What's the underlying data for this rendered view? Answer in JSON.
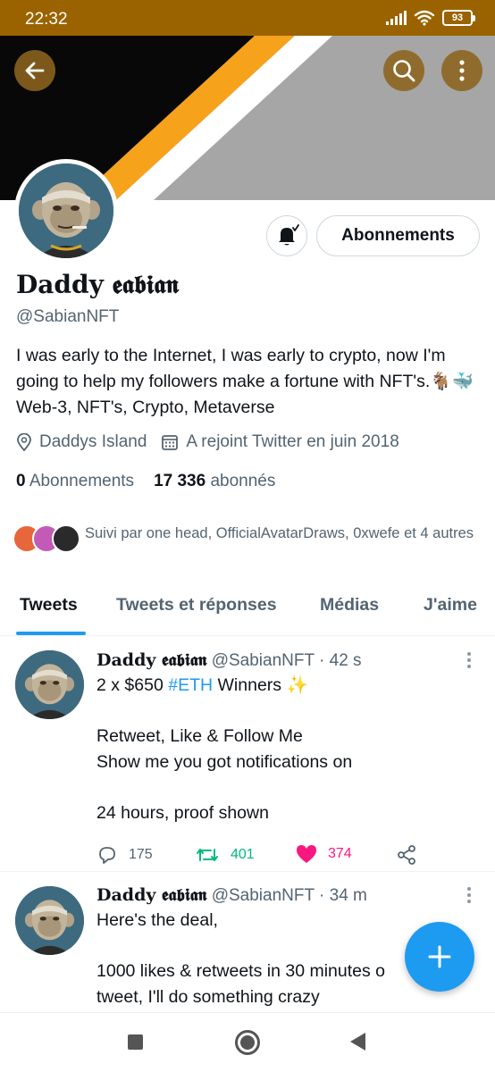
{
  "status_bar": {
    "time": "22:32",
    "battery": "93"
  },
  "banner": {
    "back_icon": "arrow-left-icon",
    "search_icon": "search-icon",
    "more_icon": "more-vertical-icon"
  },
  "profile": {
    "display_name": "Daddy 𝖊𝖆𝖇𝖎𝖆𝖓",
    "handle": "@SabianNFT",
    "bio": "I was early to the Internet, I was early to crypto, now I'm going to help my followers make a fortune with NFT's.🐐🐳 Web-3, NFT's, Crypto, Metaverse",
    "location": "Daddys Island",
    "joined": "A rejoint Twitter en juin 2018",
    "following_count": "0",
    "following_label": "Abonnements",
    "followers_count": "17 336",
    "followers_label": "abonnés",
    "follow_button": "Abonnements",
    "followed_by": "Suivi par one head, OfficialAvatarDraws, 0xwefe et 4 autres"
  },
  "tabs": [
    "Tweets",
    "Tweets et réponses",
    "Médias",
    "J'aime"
  ],
  "tweets": [
    {
      "name": "Daddy 𝖊𝖆𝖇𝖎𝖆𝖓",
      "handle": "@SabianNFT",
      "time": "· 42 s",
      "line1_pre": "2 x $650 ",
      "line1_tag": "#ETH",
      "line1_post": " Winners ✨",
      "line2": "Retweet, Like & Follow Me",
      "line3": "Show me you got notifications on",
      "line4": "24 hours, proof shown",
      "replies": "175",
      "retweets": "401",
      "likes": "374"
    },
    {
      "name": "Daddy 𝖊𝖆𝖇𝖎𝖆𝖓",
      "handle": "@SabianNFT",
      "time": "· 34 m",
      "line1": "Here's the deal,",
      "line2": "1000 likes & retweets in 30 minutes o",
      "line3": "tweet, I'll do something crazy"
    }
  ],
  "colors": {
    "accent": "#1d9bf0",
    "like": "#f91880",
    "retweet": "#00ba7c",
    "status_bar": "#9b6300"
  }
}
